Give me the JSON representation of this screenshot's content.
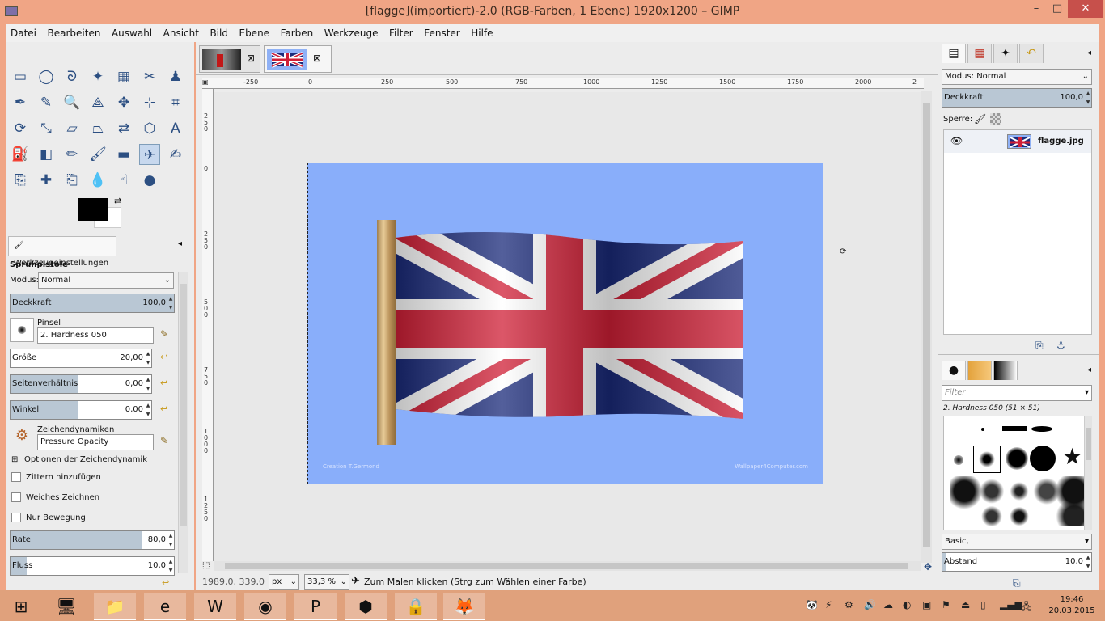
{
  "window": {
    "title": "[flagge](importiert)-2.0 (RGB-Farben, 1 Ebene) 1920x1200 – GIMP",
    "min": "–",
    "max": "□",
    "close": "✕"
  },
  "menu": [
    "Datei",
    "Bearbeiten",
    "Auswahl",
    "Ansicht",
    "Bild",
    "Ebene",
    "Farben",
    "Werkzeuge",
    "Filter",
    "Fenster",
    "Hilfe"
  ],
  "tools": {
    "rows": [
      [
        "rect-select-icon",
        "ellipse-select-icon",
        "free-select-icon",
        "fuzzy-select-icon",
        "color-select-icon",
        "scissors-icon",
        "foreground-select-icon"
      ],
      [
        "paths-icon",
        "color-picker-icon",
        "zoom-icon",
        "measure-icon",
        "move-icon",
        "align-icon",
        "crop-icon"
      ],
      [
        "rotate-icon",
        "scale-icon",
        "shear-icon",
        "perspective-icon",
        "flip-icon",
        "cage-icon",
        "text-icon"
      ],
      [
        "bucket-fill-icon",
        "blend-icon",
        "pencil-icon",
        "paintbrush-icon",
        "eraser-icon",
        "airbrush-icon",
        "ink-icon"
      ],
      [
        "clone-icon",
        "heal-icon",
        "perspective-clone-icon",
        "blur-icon",
        "smudge-icon",
        "dodge-burn-icon"
      ]
    ],
    "glyphs": {
      "rect-select-icon": "▭",
      "ellipse-select-icon": "◯",
      "free-select-icon": "ᘐ",
      "fuzzy-select-icon": "✦",
      "color-select-icon": "▦",
      "scissors-icon": "✂",
      "foreground-select-icon": "♟",
      "paths-icon": "✒",
      "color-picker-icon": "✎",
      "zoom-icon": "🔍",
      "measure-icon": "⟁",
      "move-icon": "✥",
      "align-icon": "⊹",
      "crop-icon": "⌗",
      "rotate-icon": "⟳",
      "scale-icon": "⤡",
      "shear-icon": "▱",
      "perspective-icon": "⏢",
      "flip-icon": "⇄",
      "cage-icon": "⬡",
      "text-icon": "A",
      "bucket-fill-icon": "⛽",
      "blend-icon": "◧",
      "pencil-icon": "✏",
      "paintbrush-icon": "🖌",
      "eraser-icon": "▬",
      "airbrush-icon": "✈",
      "ink-icon": "✍",
      "clone-icon": "⎘",
      "heal-icon": "✚",
      "perspective-clone-icon": "⎗",
      "blur-icon": "💧",
      "smudge-icon": "☝",
      "dodge-burn-icon": "●"
    },
    "selected": "airbrush-icon"
  },
  "tool_options": {
    "tab_label": "Werkzeugeinstellungen",
    "tool_name": "Sprühpistole",
    "mode_label": "Modus:",
    "mode_value": "Normal",
    "opacity_label": "Deckkraft",
    "opacity_value": "100,0",
    "opacity_fraction": 1.0,
    "brush_label": "Pinsel",
    "brush_value": "2. Hardness 050",
    "size_label": "Größe",
    "size_value": "20,00",
    "aspect_label": "Seitenverhältnis",
    "aspect_value": "0,00",
    "angle_label": "Winkel",
    "angle_value": "0,00",
    "dynamics_label": "Zeichendynamiken",
    "dynamics_value": "Pressure Opacity",
    "dynamics_options": "Optionen der Zeichendynamik",
    "jitter": "Zittern hinzufügen",
    "smooth": "Weiches Zeichnen",
    "motion_only": "Nur Bewegung",
    "rate_label": "Rate",
    "rate_value": "80,0",
    "rate_fraction": 0.8,
    "flow_label": "Fluss",
    "flow_value": "10,0",
    "flow_fraction": 0.1
  },
  "canvas": {
    "ruler_h": [
      "-250",
      "0",
      "250",
      "500",
      "750",
      "1000",
      "1250",
      "1500",
      "1750",
      "2000",
      "2"
    ],
    "ruler_v": [
      "250",
      "0",
      "250",
      "500",
      "750",
      "1000",
      "1250"
    ],
    "watermark_left": "Creation T.Germond",
    "watermark_right": "Wallpaper4Computer.com",
    "status_coords": "1989,0, 339,0",
    "status_unit": "px",
    "status_zoom": "33,3 %",
    "status_message": "Zum Malen klicken (Strg zum Wählen einer Farbe)"
  },
  "layers": {
    "mode_label": "Modus:",
    "mode_value": "Normal",
    "opacity_label": "Deckkraft",
    "opacity_value": "100,0",
    "lock_label": "Sperre:",
    "layer_name": "flagge.jpg"
  },
  "brushes": {
    "filter_placeholder": "Filter",
    "current": "2. Hardness 050 (51 × 51)",
    "tag": "Basic,",
    "spacing_label": "Abstand",
    "spacing_value": "10,0",
    "spacing_fraction": 0.02
  },
  "taskbar": {
    "apps": [
      "windows-start-icon",
      "network-icon",
      "file-explorer-icon",
      "internet-explorer-icon",
      "word-icon",
      "chrome-icon",
      "powerpoint-icon",
      "virtualbox-icon",
      "vpn-icon",
      "gimp-icon"
    ],
    "glyphs": {
      "windows-start-icon": "⊞",
      "network-icon": "🖥",
      "file-explorer-icon": "📁",
      "internet-explorer-icon": "e",
      "word-icon": "W",
      "chrome-icon": "◉",
      "powerpoint-icon": "P",
      "virtualbox-icon": "⬢",
      "vpn-icon": "🔒",
      "gimp-icon": "🦊"
    },
    "time": "19:46",
    "date": "20.03.2015"
  },
  "colors": {
    "canvas_bg": "#89aefa",
    "flag_blue": "#1a2a7a",
    "flag_red": "#d01f36",
    "title_bg": "#f0a585"
  }
}
